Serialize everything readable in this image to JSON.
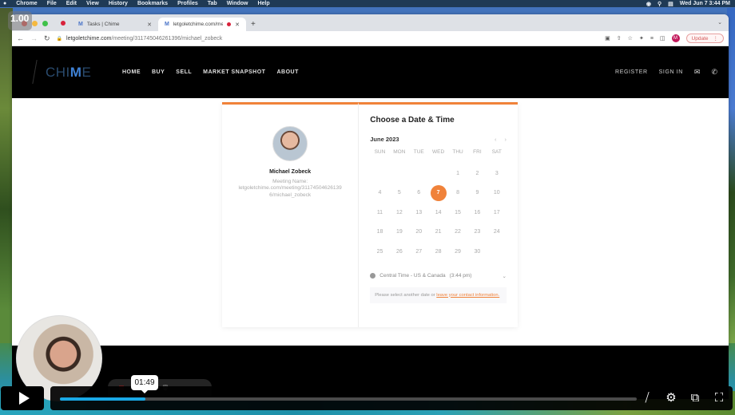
{
  "menubar": {
    "app": "Chrome",
    "items": [
      "File",
      "Edit",
      "View",
      "History",
      "Bookmarks",
      "Profiles",
      "Tab",
      "Window",
      "Help"
    ],
    "clock": "Wed Jun 7  3:44 PM"
  },
  "overlay": {
    "speed": "1.00"
  },
  "browser": {
    "tabs": [
      {
        "label": "Tasks | Chime",
        "active": false
      },
      {
        "label": "letgoletchime.com/meeting",
        "active": true,
        "recording": true
      }
    ],
    "url_host": "letgoletchime.com",
    "url_path": "/meeting/311745046261396/michael_zobeck",
    "profile_initial": "M",
    "update_label": "Update"
  },
  "site": {
    "logo_prefix": "CHI",
    "logo_highlight": "M",
    "logo_suffix": "E",
    "nav": [
      "HOME",
      "BUY",
      "SELL",
      "MARKET SNAPSHOT",
      "ABOUT"
    ],
    "nav_right": [
      "REGISTER",
      "SIGN IN"
    ]
  },
  "scheduler": {
    "host_name": "Michael Zobeck",
    "meeting_label": "Meeting Name:",
    "meeting_url": "letgoletchime.com/meeting/311745046261396/michael_zobeck",
    "title": "Choose a Date & Time",
    "month": "June 2023",
    "weekdays": [
      "SUN",
      "MON",
      "TUE",
      "WED",
      "THU",
      "FRI",
      "SAT"
    ],
    "first_weekday_index": 4,
    "days_in_month": 30,
    "selected_day": 7,
    "timezone": "Central Time - US & Canada",
    "current_time": "(3:44 pm)",
    "notice_text": "Please select another date or ",
    "notice_link": "leave your contact information.",
    "accent_color": "#f0823a"
  },
  "player": {
    "hover_time": "01:49",
    "progress_fraction": 0.148
  }
}
